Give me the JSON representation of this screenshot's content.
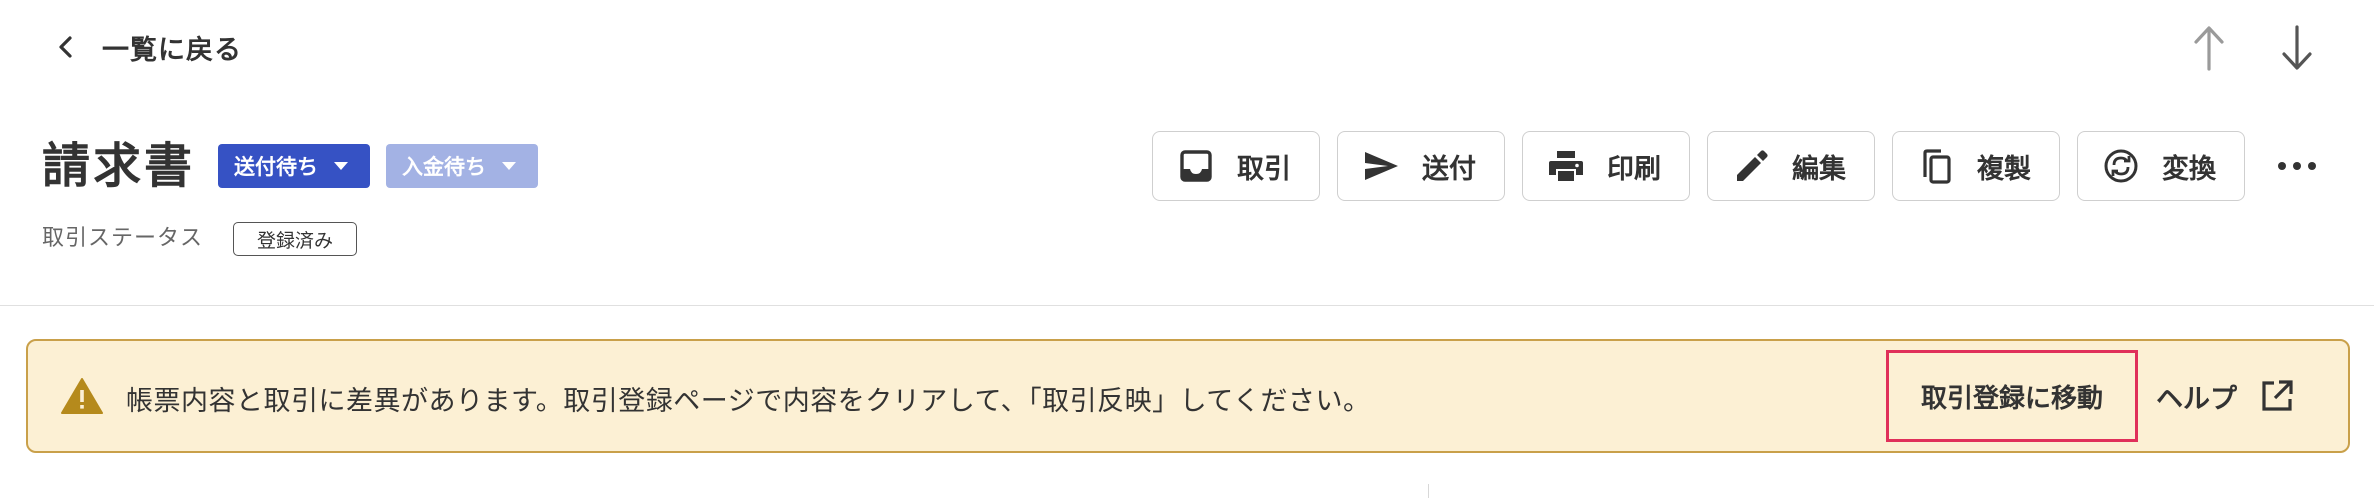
{
  "header": {
    "back_label": "一覧に戻る"
  },
  "document": {
    "title": "請求書",
    "send_status": "送付待ち",
    "payment_status": "入金待ち",
    "deal_status_label": "取引ステータス",
    "deal_status_value": "登録済み"
  },
  "actions": [
    {
      "label": "取引",
      "icon": "inbox-icon"
    },
    {
      "label": "送付",
      "icon": "send-icon"
    },
    {
      "label": "印刷",
      "icon": "print-icon"
    },
    {
      "label": "編集",
      "icon": "edit-icon"
    },
    {
      "label": "複製",
      "icon": "copy-icon"
    },
    {
      "label": "変換",
      "icon": "convert-icon"
    }
  ],
  "alert": {
    "message": "帳票内容と取引に差異があります。取引登録ページで内容をクリアして、「取引反映」してください。",
    "move_button": "取引登録に移動",
    "help_label": "ヘルプ"
  },
  "colors": {
    "send_status_bg": "#3652c4",
    "payment_status_bg": "#a3b2e4",
    "alert_bg": "#fcf0d4",
    "alert_border": "#c9a04a",
    "highlight_border": "#e0305a",
    "warning_icon": "#b58a1c"
  }
}
